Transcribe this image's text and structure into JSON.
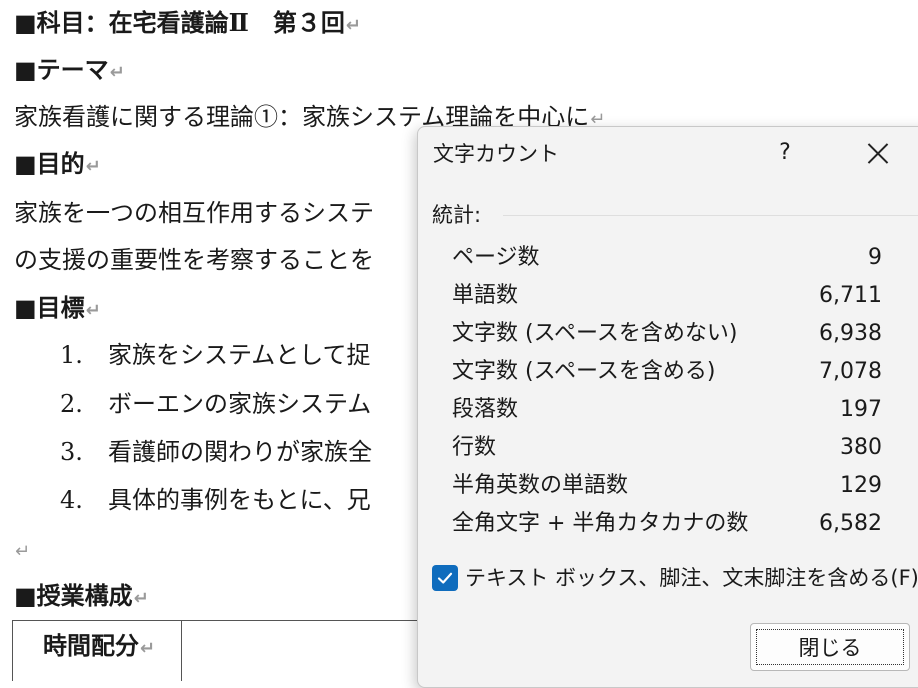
{
  "document": {
    "heading_subject": "■科目：在宅看護論Ⅱ　第３回",
    "heading_theme": "■テーマ",
    "theme_text": "家族看護に関する理論①：家族システム理論を中心に",
    "heading_purpose": "■目的",
    "purpose_line1": "家族を一つの相互作用するシステ",
    "purpose_line2": "の支援の重要性を考察することを",
    "heading_goals": "■目標",
    "goals": [
      {
        "num": "1.",
        "text": "家族をシステムとして捉"
      },
      {
        "num": "2.",
        "text": "ボーエンの家族システム"
      },
      {
        "num": "3.",
        "text": "看護師の関わりが家族全"
      },
      {
        "num": "4.",
        "text": "具体的事例をもとに、兄"
      }
    ],
    "paragraph_mark": "↵",
    "heading_structure": "■授業構成",
    "table_header_time": "時間配分"
  },
  "dialog": {
    "title": "文字カウント",
    "help_label": "?",
    "stats_label": "統計:",
    "stats": [
      {
        "label": "ページ数",
        "value": "9"
      },
      {
        "label": "単語数",
        "value": "6,711"
      },
      {
        "label": "文字数 (スペースを含めない)",
        "value": "6,938"
      },
      {
        "label": "文字数 (スペースを含める)",
        "value": "7,078"
      },
      {
        "label": "段落数",
        "value": "197"
      },
      {
        "label": "行数",
        "value": "380"
      },
      {
        "label": "半角英数の単語数",
        "value": "129"
      },
      {
        "label": "全角文字 + 半角カタカナの数",
        "value": "6,582"
      }
    ],
    "include_checkbox_label": "テキスト ボックス、脚注、文末脚注を含める(F)",
    "include_checked": true,
    "close_button_label": "閉じる"
  },
  "colors": {
    "accent": "#0f6cbd",
    "dialog_bg": "#f3f3f3",
    "paragraph_mark": "#9a9a9a"
  }
}
